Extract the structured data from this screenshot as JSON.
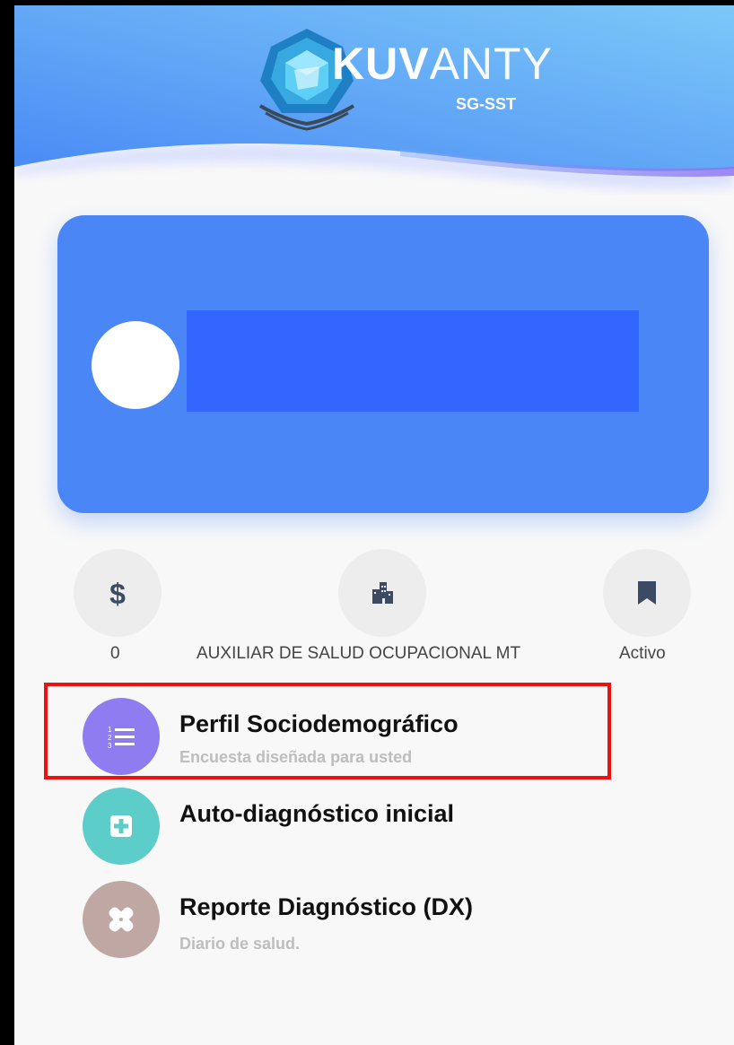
{
  "header": {
    "logo_bold": "KUV",
    "logo_light": "ANTY",
    "logo_sub": "SG-SST",
    "gradient": [
      "#4a8af5",
      "#7cc8f8"
    ]
  },
  "profile": {
    "card_color": "#4a86f5",
    "name_redaction_color": "#3366ff"
  },
  "stats": [
    {
      "icon": "dollar-icon",
      "value": "0"
    },
    {
      "icon": "building-icon",
      "value": "AUXILIAR DE SALUD OCUPACIONAL MT"
    },
    {
      "icon": "bookmark-icon",
      "value": "Activo"
    }
  ],
  "menu": [
    {
      "icon": "list-numbered-icon",
      "title": "Perfil Sociodemográfico",
      "subtitle": "Encuesta diseñada para usted",
      "color": "#8e7cf0"
    },
    {
      "icon": "medical-plus-icon",
      "title": "Auto-diagnóstico inicial",
      "subtitle": "",
      "color": "#5ccdc9"
    },
    {
      "icon": "bandage-icon",
      "title": "Reporte Diagnóstico (DX)",
      "subtitle": "Diario de salud.",
      "color": "#bfa8a4"
    }
  ],
  "annotation_color": "#ee1111"
}
